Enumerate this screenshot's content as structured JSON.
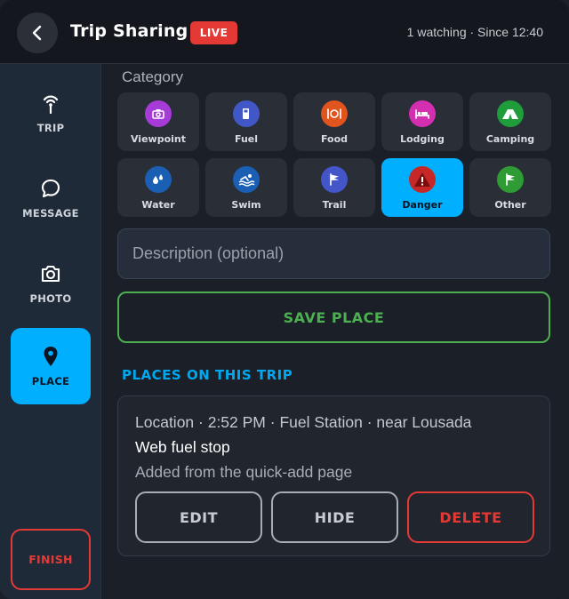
{
  "header": {
    "title": "Trip Sharing",
    "live_badge": "LIVE",
    "status": "1 watching · Since 12:40",
    "back_icon": "chevron-left-icon"
  },
  "sidebar": {
    "items": [
      {
        "label": "TRIP",
        "icon": "broadcast-icon",
        "active": false
      },
      {
        "label": "MESSAGE",
        "icon": "chat-bubble-icon",
        "active": false
      },
      {
        "label": "PHOTO",
        "icon": "camera-icon",
        "active": false
      },
      {
        "label": "PLACE",
        "icon": "map-pin-icon",
        "active": true
      }
    ],
    "finish_label": "FINISH"
  },
  "main": {
    "category_label": "Category",
    "categories": [
      {
        "label": "Viewpoint",
        "icon": "camera-icon",
        "color": "#a63bd8"
      },
      {
        "label": "Fuel",
        "icon": "fuel-pump-icon",
        "color": "#4157c8"
      },
      {
        "label": "Food",
        "icon": "plate-cutlery-icon",
        "color": "#e0541d"
      },
      {
        "label": "Lodging",
        "icon": "bed-icon",
        "color": "#d42fb0"
      },
      {
        "label": "Camping",
        "icon": "tent-icon",
        "color": "#1f9d3a"
      },
      {
        "label": "Water",
        "icon": "water-drops-icon",
        "color": "#1a5fb4"
      },
      {
        "label": "Swim",
        "icon": "swimmer-icon",
        "color": "#1a5fb4"
      },
      {
        "label": "Trail",
        "icon": "flag-icon",
        "color": "#4355c9"
      },
      {
        "label": "Danger",
        "icon": "warning-icon",
        "color": "#e53935",
        "active": true
      },
      {
        "label": "Other",
        "icon": "flag-icon",
        "color": "#2e9b34"
      }
    ],
    "description_placeholder": "Description (optional)",
    "save_label": "SAVE PLACE",
    "places_heading": "PLACES ON THIS TRIP",
    "places": [
      {
        "meta": "Location · 2:52 PM · Fuel Station · near Lousada",
        "name": "Web fuel stop",
        "note": "Added from the quick-add page",
        "edit_label": "EDIT",
        "hide_label": "HIDE",
        "delete_label": "DELETE"
      }
    ]
  },
  "colors": {
    "accent": "#00b0ff",
    "live": "#e53935",
    "save": "#4caf50",
    "danger": "#e53935"
  }
}
